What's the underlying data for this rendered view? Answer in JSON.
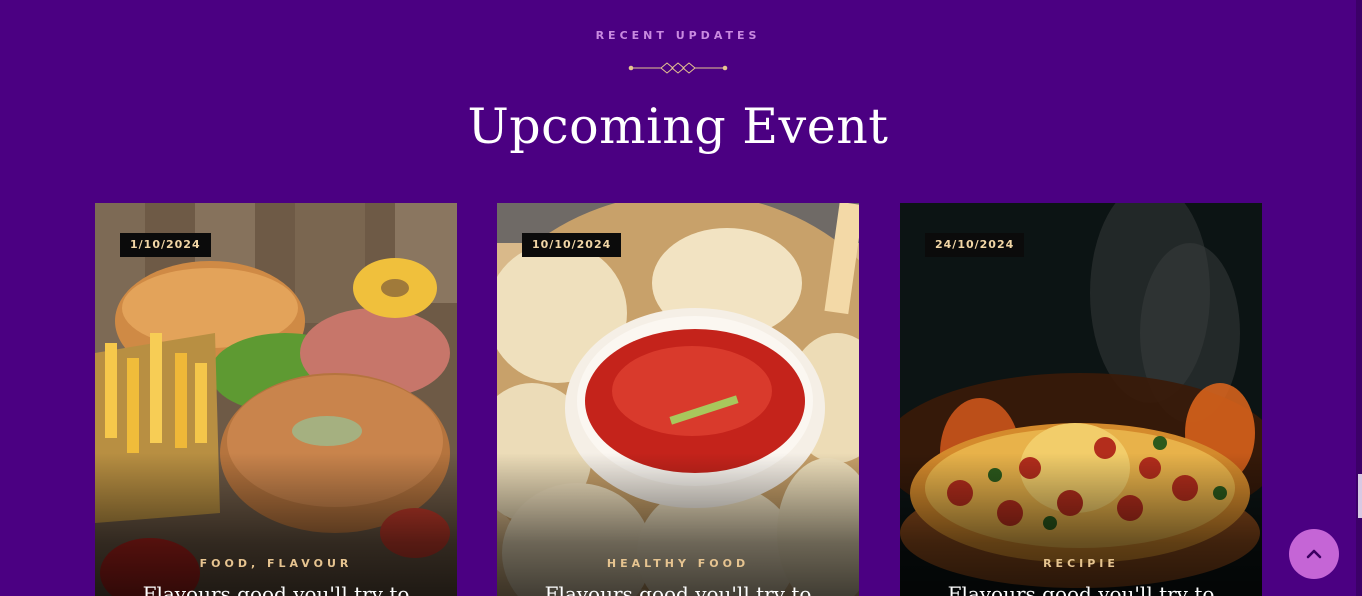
{
  "section": {
    "eyebrow": "RECENT UPDATES",
    "title": "Upcoming Event"
  },
  "cards": [
    {
      "date": "1/10/2024",
      "category": "FOOD, FLAVOUR",
      "headline": "Flavours good you'll try to",
      "image": "fast-food-burgers-fries"
    },
    {
      "date": "10/10/2024",
      "category": "HEALTHY FOOD",
      "headline": "Flavours good you'll try to",
      "image": "momos-with-red-chutney"
    },
    {
      "date": "24/10/2024",
      "category": "RECIPIE",
      "headline": "Flavours good you'll try to",
      "image": "flaming-cheese-pizza"
    }
  ],
  "icons": {
    "divider": "diamond-divider-icon",
    "scroll_top": "chevron-up-icon"
  },
  "colors": {
    "background": "#4b0082",
    "eyebrow": "#c98ae0",
    "date_badge_bg": "#0b0b0b",
    "date_badge_text": "#f1d6a6",
    "category": "#e6c490",
    "scroll_button": "#c565d6"
  }
}
